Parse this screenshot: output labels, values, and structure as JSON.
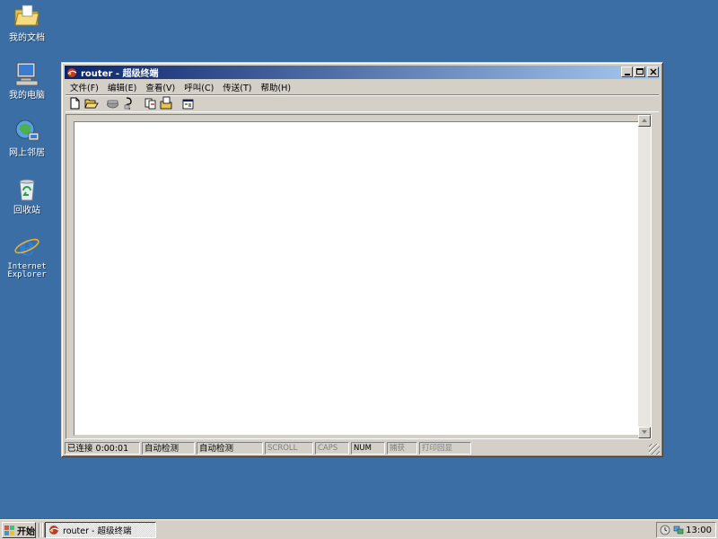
{
  "desktop": {
    "icons": [
      {
        "label": "我的文档"
      },
      {
        "label": "我的电脑"
      },
      {
        "label": "网上邻居"
      },
      {
        "label": "回收站"
      },
      {
        "label1": "Internet",
        "label2": "Explorer"
      }
    ]
  },
  "window": {
    "title": "router - 超级终端",
    "menu": [
      "文件(F)",
      "编辑(E)",
      "查看(V)",
      "呼叫(C)",
      "传送(T)",
      "帮助(H)"
    ],
    "status": [
      "已连接 0:00:01",
      "自动检测",
      "自动检测",
      "SCROLL",
      "CAPS",
      "NUM",
      "捕获",
      "打印回显"
    ]
  },
  "taskbar": {
    "start_label": "开始",
    "task_label": "router - 超级终端",
    "clock": "13:00"
  },
  "colors": {
    "desktop": "#3a6ea5",
    "title_active_start": "#0a246a",
    "title_active_end": "#a6caf0",
    "face": "#d4d0c8"
  }
}
